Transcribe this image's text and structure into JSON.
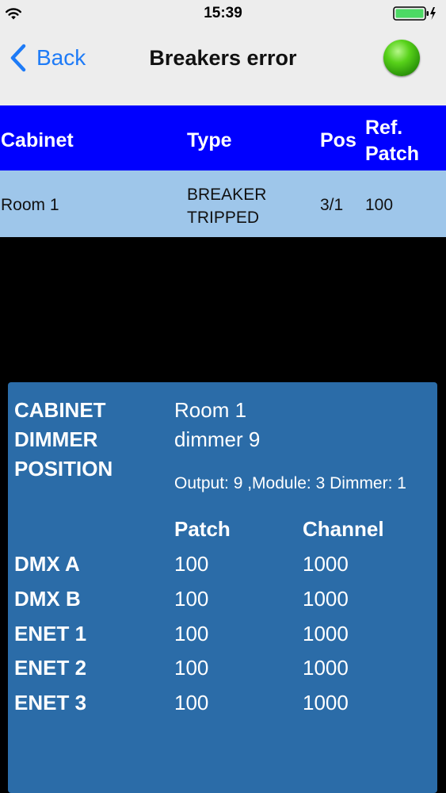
{
  "status_bar": {
    "time": "15:39"
  },
  "nav": {
    "back_label": "Back",
    "title": "Breakers error",
    "status_color": "#3ab80f"
  },
  "table": {
    "headers": {
      "cabinet": "Cabinet",
      "type": "Type",
      "pos": "Pos",
      "ref_line1": "Ref.",
      "ref_line2": "Patch"
    },
    "rows": [
      {
        "cabinet": "Room 1",
        "type_line1": "BREAKER",
        "type_line2": "TRIPPED",
        "pos": "3/1",
        "ref_patch": "100"
      }
    ]
  },
  "detail": {
    "cabinet_label": "CABINET",
    "cabinet_value": "Room 1",
    "dimmer_label": "DIMMER",
    "dimmer_value": "dimmer 9",
    "position_label": "POSITION",
    "position_value": "Output: 9 ,Module: 3 Dimmer: 1",
    "patch_header": "Patch",
    "channel_header": "Channel",
    "rows": [
      {
        "label": "DMX  A",
        "patch": "100",
        "channel": "1000"
      },
      {
        "label": "DMX  B",
        "patch": "100",
        "channel": "1000"
      },
      {
        "label": "ENET 1",
        "patch": "100",
        "channel": "1000"
      },
      {
        "label": "ENET 2",
        "patch": "100",
        "channel": "1000"
      },
      {
        "label": "ENET 3",
        "patch": "100",
        "channel": "1000"
      }
    ]
  },
  "colors": {
    "header_blue": "#0000ff",
    "row_light_blue": "#9ec6ea",
    "panel_blue": "#2b6ca8",
    "ios_blue": "#1e7bf7",
    "battery_green": "#4cd964"
  }
}
